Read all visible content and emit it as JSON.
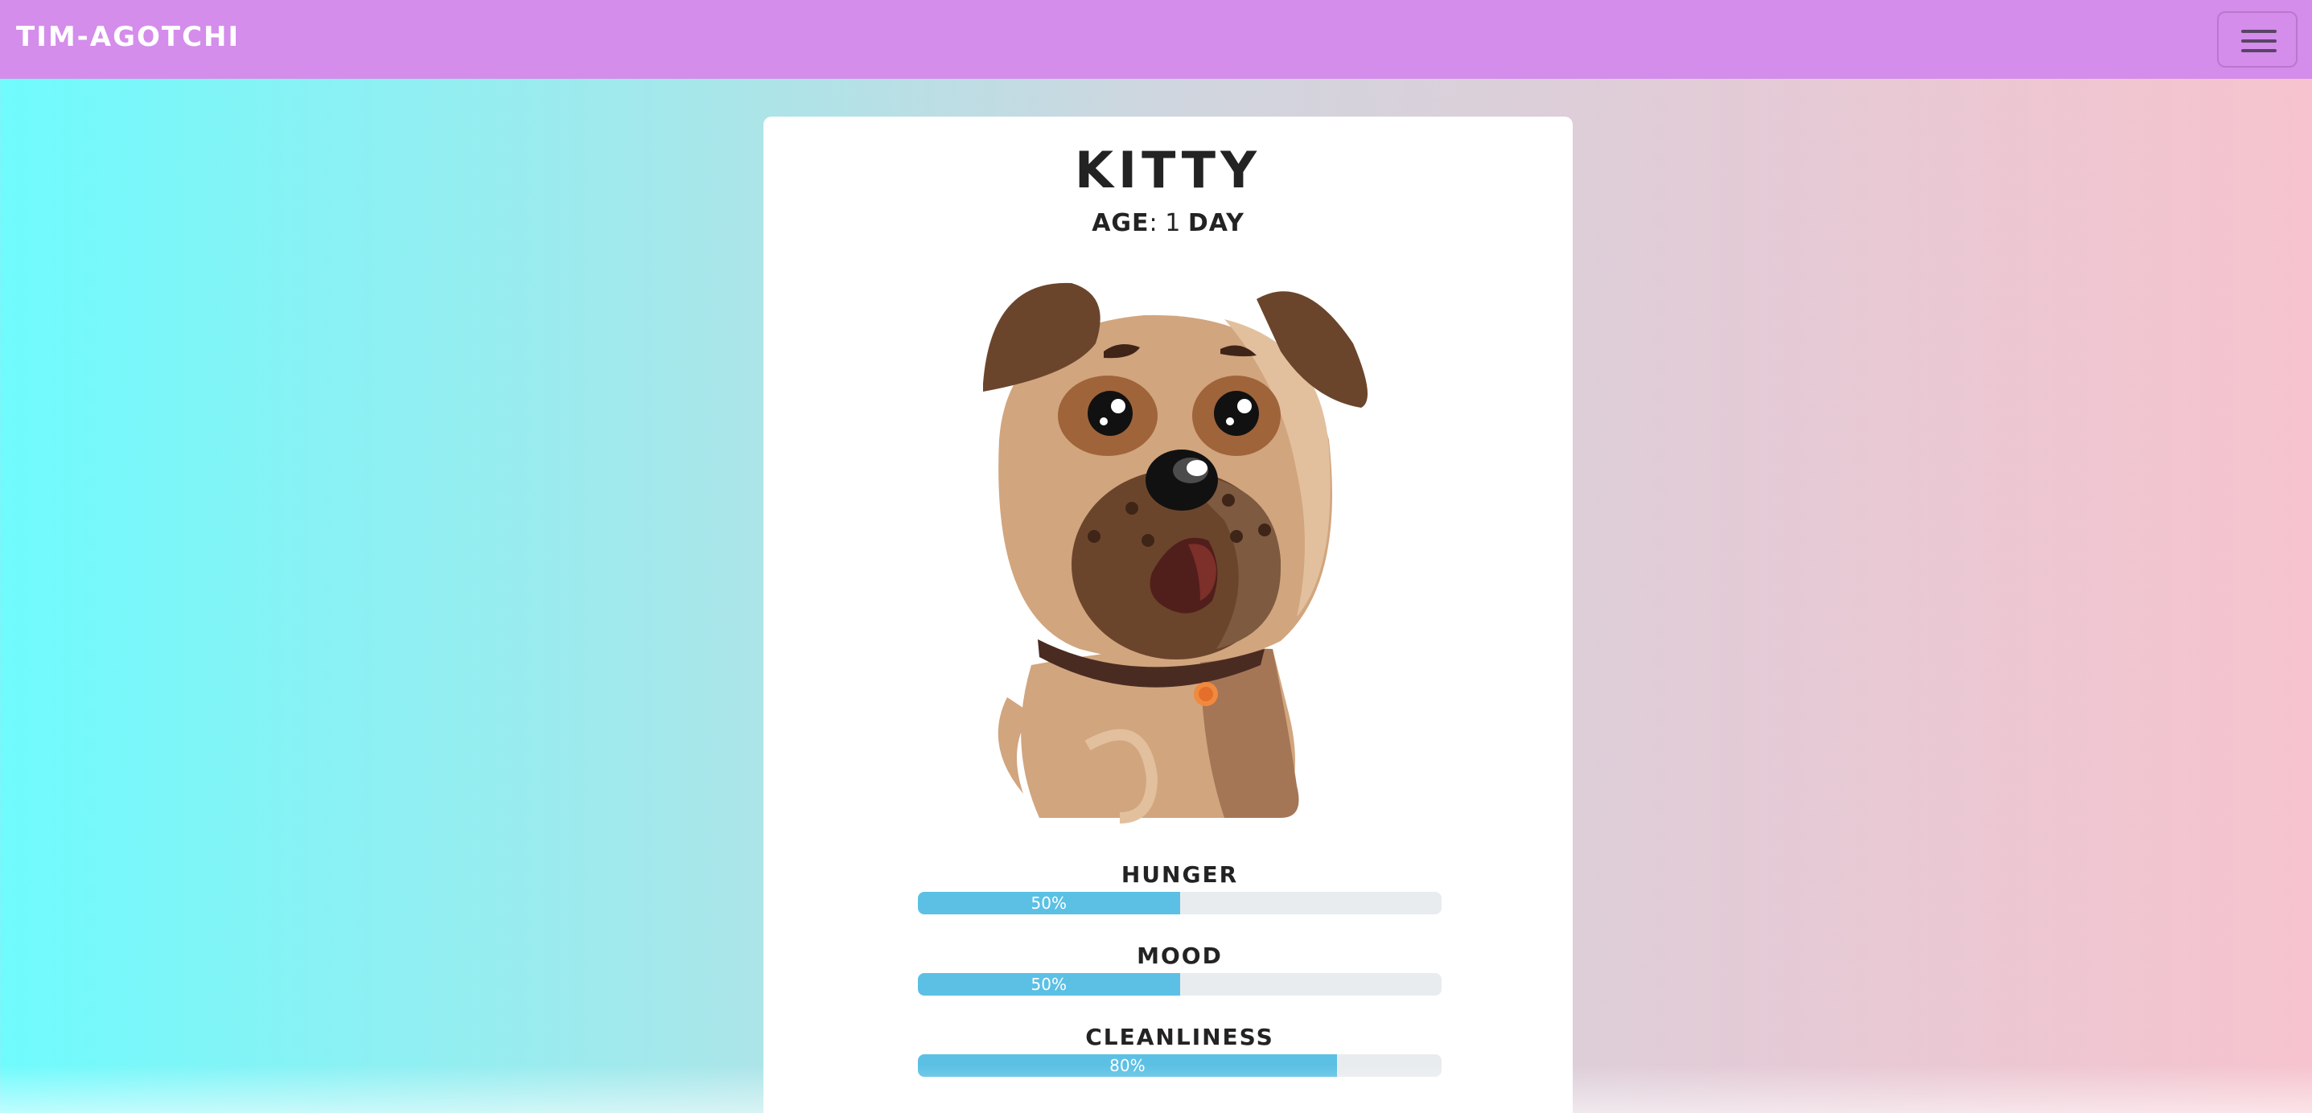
{
  "navbar": {
    "brand": "TIM-AGOTCHI",
    "menu_icon": "hamburger-menu-icon",
    "bg_color": "#d48deb"
  },
  "pet": {
    "name": "KITTY",
    "age_label": "AGE",
    "age_separator": ":",
    "age_value": "1",
    "age_unit": "DAY",
    "image": "cartoon-pug-dog"
  },
  "stats": [
    {
      "label": "HUNGER",
      "value": 50,
      "display": "50%"
    },
    {
      "label": "MOOD",
      "value": 50,
      "display": "50%"
    },
    {
      "label": "CLEANLINESS",
      "value": 80,
      "display": "80%"
    }
  ],
  "colors": {
    "progress_fill": "#5bc0e4",
    "progress_track": "#e9ecef"
  }
}
